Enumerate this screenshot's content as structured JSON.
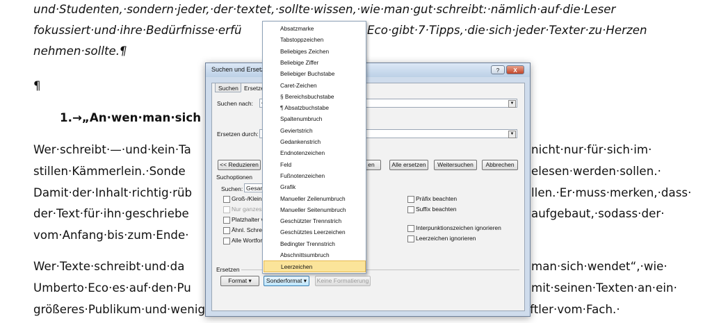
{
  "document": {
    "lines": [
      "und·Studenten,·sondern·jeder,·der·textet,·sollte·wissen,·wie·man·gut·schreibt:·nämlich·auf·die·Leser",
      "fokussiert·und·ihre·Bedürfnisse·erfü",
      "Eco·gibt·7·Tipps,·die·sich·jeder·Texter·zu·Herzen",
      "nehmen·sollte.¶",
      "¶",
      "1.→„An·wen·man·sich",
      "Wer·schreibt·—·und·kein·Ta",
      "nicht·nur·für·sich·im·",
      "stillen·Kämmerlein.·Sonde",
      "elesen·werden·sollen.·",
      "Damit·der·Inhalt·richtig·rüb",
      "llen.·Er·muss·merken,·dass·",
      "der·Text·für·ihn·geschriebe",
      "aufgebaut,·sodass·der·",
      "vom·Anfang·bis·zum·Ende·",
      "Wer·Texte·schreibt·und·da",
      "man·sich·wendet“,·wie·",
      "Umberto·Eco·es·auf·den·Pu",
      "mit·seinen·Texten·an·ein·",
      "größeres·Publikum·und·weniger·an·einen·elitären·Kreis·von·Experten·und·Wissenschaftler·vom·Fach.·"
    ]
  },
  "dialog": {
    "title": "Suchen und Ersetzen",
    "help": "?",
    "close": "X",
    "tabs": [
      "Suchen",
      "Ersetzen"
    ],
    "search_label": "Suchen nach:",
    "search_value": "^",
    "replace_label": "Ersetzen durch:",
    "replace_value": "",
    "buttons": {
      "less": "<< Reduzieren",
      "replace": "en",
      "replace_all": "Alle ersetzen",
      "find_next": "Weitersuchen",
      "cancel": "Abbrechen"
    },
    "options_title": "Suchoptionen",
    "search_dir_label": "Suchen:",
    "search_dir_value": "Gesam",
    "left_options": [
      {
        "label": "Groß-/Kleinsch",
        "enabled": true
      },
      {
        "label": "Nur ganzes W",
        "enabled": false
      },
      {
        "label": "Platzhalter ver",
        "enabled": true
      },
      {
        "label": "Ähnl. Schreibv",
        "enabled": true
      },
      {
        "label": "Alle Wortform",
        "enabled": true
      }
    ],
    "right_options": [
      {
        "label": "Präfix beachten"
      },
      {
        "label": "Suffix beachten"
      },
      {
        "label": "Interpunktionszeichen ignorieren"
      },
      {
        "label": "Leerzeichen ignorieren"
      }
    ],
    "replace_section_title": "Ersetzen",
    "format_button": "Format ▾",
    "special_button": "Sonderformat ▾",
    "no_format_button": "Keine Formatierung"
  },
  "special_menu": {
    "items": [
      "Absatzmarke",
      "Tabstoppzeichen",
      "Beliebiges Zeichen",
      "Beliebige Ziffer",
      "Beliebiger Buchstabe",
      "Caret-Zeichen",
      "§ Bereichsbuchstabe",
      "¶ Absatzbuchstabe",
      "Spaltenumbruch",
      "Geviertstrich",
      "Gedankenstrich",
      "Endnotenzeichen",
      "Feld",
      "Fußnotenzeichen",
      "Grafik",
      "Manueller Zeilenumbruch",
      "Manueller Seitenumbruch",
      "Geschützter Trennstrich",
      "Geschütztes Leerzeichen",
      "Bedingter Trennstrich",
      "Abschnittsumbruch",
      "Leerzeichen"
    ],
    "highlighted": "Leerzeichen"
  }
}
